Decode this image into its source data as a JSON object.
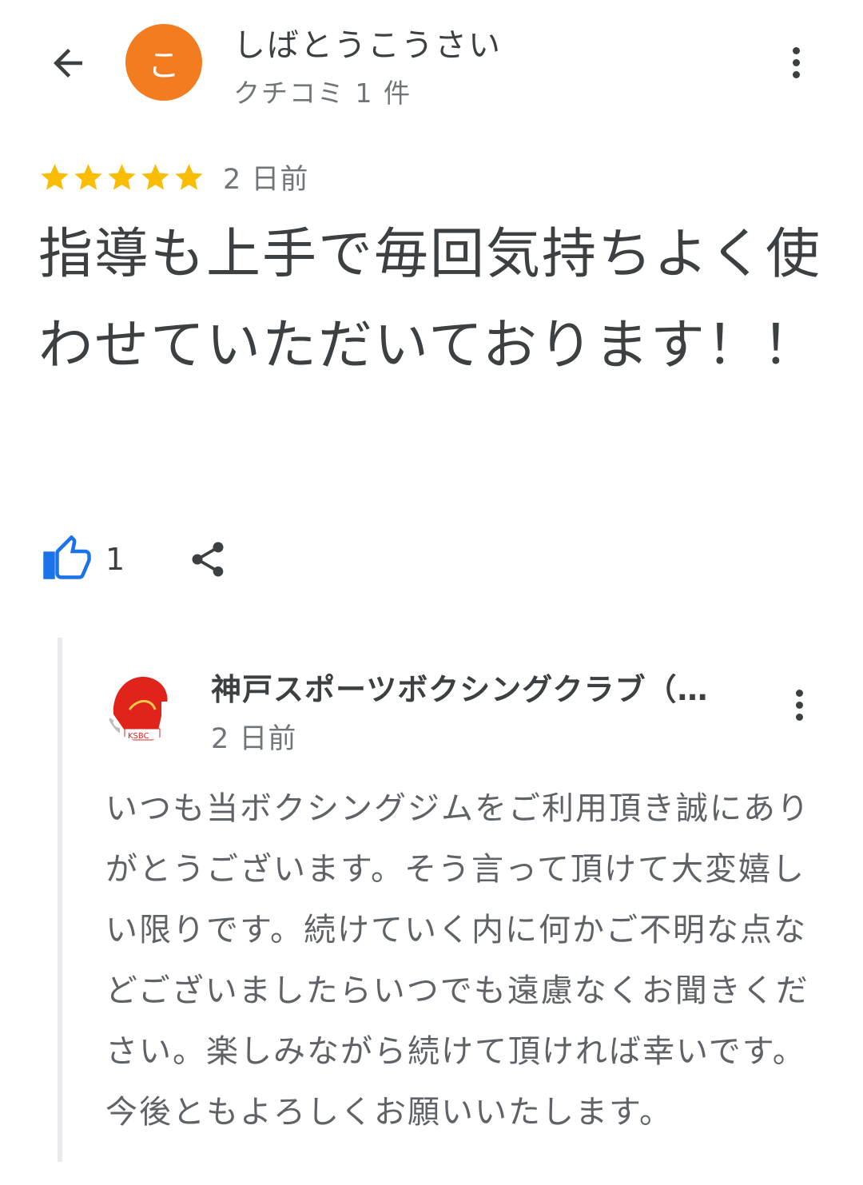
{
  "header": {
    "back_icon": "arrow-back-icon",
    "avatar_letter": "こ",
    "avatar_color": "#f47c20",
    "user_name": "しばとうこうさい",
    "review_count": "クチコミ 1 件",
    "menu_icon": "more-vert-icon"
  },
  "review": {
    "rating": 5,
    "rating_max": 5,
    "star_color": "#fbbc04",
    "date": "2 日前",
    "text": "指導も上手で毎回気持ちよく使わせていただいております！！"
  },
  "actions": {
    "like_icon": "thumb-up-icon",
    "like_color": "#1a73e8",
    "like_count": "1",
    "share_icon": "share-icon"
  },
  "owner_reply": {
    "avatar_icon": "boxing-glove-logo-icon",
    "logo_text": "KSBC",
    "name": "神戸スポーツボクシングクラブ（…",
    "date": "2 日前",
    "menu_icon": "more-vert-icon",
    "text": "いつも当ボクシングジムをご利用頂き誠にありがとうございます。そう言って頂けて大変嬉しい限りです。続けていく内に何かご不明な点などございましたらいつでも遠慮なくお聞きください。楽しみながら続けて頂ければ幸いです。今後ともよろしくお願いいたします。"
  }
}
